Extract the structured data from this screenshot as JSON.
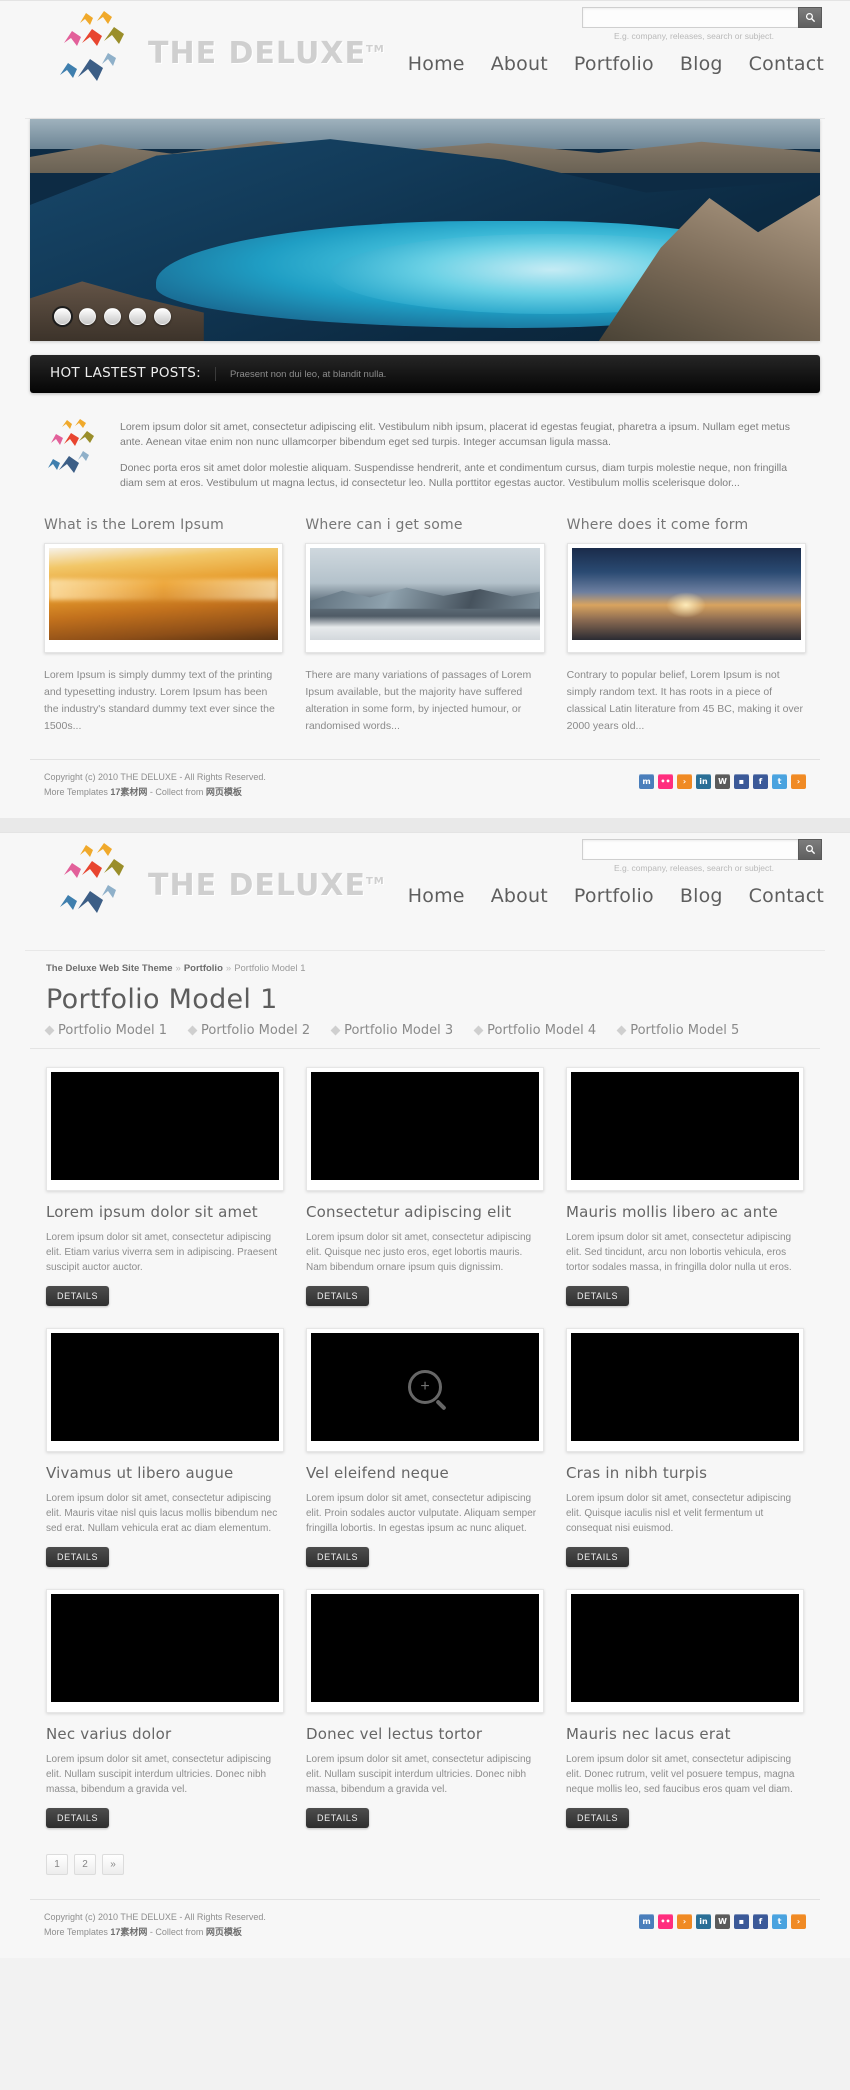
{
  "brand": {
    "name": "THE DELUXE",
    "tm": "TM",
    "logo_icon": "birds-logo-icon"
  },
  "search": {
    "value": "",
    "placeholder": "",
    "hint": "E.g. company, releases, search or subject.",
    "button_icon": "search-icon"
  },
  "nav": {
    "items": [
      {
        "label": "Home"
      },
      {
        "label": "About"
      },
      {
        "label": "Portfolio"
      },
      {
        "label": "Blog"
      },
      {
        "label": "Contact"
      }
    ]
  },
  "slider": {
    "dots": [
      "1",
      "2",
      "3",
      "4",
      "5"
    ],
    "active_dot": 0,
    "image_alt": "blue-lagoon-mountain-photo"
  },
  "hot_posts": {
    "label": "HOT LASTEST POSTS:",
    "text": "Praesent non dui leo, at blandit nulla."
  },
  "intro": {
    "icon": "birds-logo-icon",
    "paragraphs": [
      "Lorem ipsum dolor sit amet, consectetur adipiscing elit. Vestibulum nibh ipsum, placerat id egestas feugiat, pharetra a ipsum. Nullam eget metus ante. Aenean vitae enim non nunc ullamcorper bibendum eget sed turpis. Integer accumsan ligula massa.",
      "Donec porta eros sit amet dolor molestie aliquam. Suspendisse hendrerit, ante et condimentum cursus, diam turpis molestie neque, non fringilla diam sem at eros. Vestibulum ut magna lectus, id consectetur leo. Nulla porttitor egestas auctor. Vestibulum mollis scelerisque dolor..."
    ]
  },
  "columns": [
    {
      "title": "What is the Lorem Ipsum",
      "image": "orange-canyon-photo",
      "text": "Lorem Ipsum is simply dummy text of the printing and typesetting industry. Lorem Ipsum has been the industry's standard dummy text ever since the 1500s..."
    },
    {
      "title": "Where can i get some",
      "image": "snow-mountain-photo",
      "text": "There are many variations of passages of Lorem Ipsum available, but the majority have suffered alteration in some form, by injected humour, or randomised words..."
    },
    {
      "title": "Where does it come form",
      "image": "sunset-clouds-photo",
      "text": "Contrary to popular belief, Lorem Ipsum is not simply random text. It has roots in a piece of classical Latin literature from 45 BC, making it over 2000 years old..."
    }
  ],
  "footer": {
    "line1": "Copyright (c) 2010 THE DELUXE - All Rights Reserved.",
    "line2_prefix": "More Templates ",
    "line2_link1": "17素材网",
    "line2_mid": " - Collect from ",
    "line2_link2": "网页模板",
    "social": [
      {
        "name": "myspace-icon",
        "glyph": "m",
        "color": "#4a7ebb"
      },
      {
        "name": "flickr-icon",
        "glyph": "••",
        "color": "#ff2e7e"
      },
      {
        "name": "rss-icon",
        "glyph": "●",
        "color": "#f08a24"
      },
      {
        "name": "linkedin-icon",
        "glyph": "in",
        "color": "#2a6f96"
      },
      {
        "name": "wordpress-icon",
        "glyph": "W",
        "color": "#5a5a5a"
      },
      {
        "name": "delicious-icon",
        "glyph": "■",
        "color": "#3b5998"
      },
      {
        "name": "facebook-icon",
        "glyph": "f",
        "color": "#3b5998"
      },
      {
        "name": "twitter-icon",
        "glyph": "t",
        "color": "#4aa3df"
      },
      {
        "name": "rss-feed-icon",
        "glyph": "●",
        "color": "#f08a24"
      }
    ]
  },
  "portfolio": {
    "breadcrumb": {
      "root": "The Deluxe Web Site Theme",
      "sep": "»",
      "section": "Portfolio",
      "current": "Portfolio Model 1"
    },
    "title": "Portfolio Model 1",
    "sub_nav": [
      {
        "label": "Portfolio Model 1"
      },
      {
        "label": "Portfolio Model 2"
      },
      {
        "label": "Portfolio Model 3"
      },
      {
        "label": "Portfolio Model 4"
      },
      {
        "label": "Portfolio Model 5"
      }
    ],
    "details_label": "DETAILS",
    "cards": [
      {
        "title": "Lorem ipsum dolor sit amet",
        "text": "Lorem ipsum dolor sit amet, consectetur adipiscing elit. Etiam varius viverra sem in adipiscing. Praesent suscipit auctor auctor.",
        "has_zoom": false
      },
      {
        "title": "Consectetur adipiscing elit",
        "text": "Lorem ipsum dolor sit amet, consectetur adipiscing elit. Quisque nec justo eros, eget lobortis mauris. Nam bibendum ornare ipsum quis dignissim.",
        "has_zoom": false
      },
      {
        "title": "Mauris mollis libero ac ante",
        "text": "Lorem ipsum dolor sit amet, consectetur adipiscing elit. Sed tincidunt, arcu non lobortis vehicula, eros tortor sodales massa, in fringilla dolor nulla ut eros.",
        "has_zoom": false
      },
      {
        "title": "Vivamus ut libero augue",
        "text": "Lorem ipsum dolor sit amet, consectetur adipiscing elit. Mauris vitae nisl quis lacus mollis bibendum nec sed erat. Nullam vehicula erat ac diam elementum.",
        "has_zoom": false
      },
      {
        "title": "Vel eleifend neque",
        "text": "Lorem ipsum dolor sit amet, consectetur adipiscing elit. Proin sodales auctor vulputate. Aliquam semper fringilla lobortis. In egestas ipsum ac nunc aliquet.",
        "has_zoom": true
      },
      {
        "title": "Cras in nibh turpis",
        "text": "Lorem ipsum dolor sit amet, consectetur adipiscing elit. Quisque iaculis nisl et velit fermentum ut consequat nisi euismod.",
        "has_zoom": false
      },
      {
        "title": "Nec varius dolor",
        "text": "Lorem ipsum dolor sit amet, consectetur adipiscing elit. Nullam suscipit interdum ultricies. Donec nibh massa, bibendum a gravida vel.",
        "has_zoom": false
      },
      {
        "title": "Donec vel lectus tortor",
        "text": "Lorem ipsum dolor sit amet, consectetur adipiscing elit. Nullam suscipit interdum ultricies. Donec nibh massa, bibendum a gravida vel.",
        "has_zoom": false
      },
      {
        "title": "Mauris nec lacus erat",
        "text": "Lorem ipsum dolor sit amet, consectetur adipiscing elit. Donec rutrum, velit vel posuere tempus, magna neque mollis leo, sed faucibus eros quam vel diam.",
        "has_zoom": false
      }
    ],
    "pagination": [
      {
        "label": "1"
      },
      {
        "label": "2"
      },
      {
        "label": "»"
      }
    ]
  },
  "colors": {
    "page_bg": "#f7f7f7",
    "text": "#7d7d7d",
    "heading": "#666666",
    "hotbar_bg": "#121212",
    "button": "#3a3a3a"
  }
}
